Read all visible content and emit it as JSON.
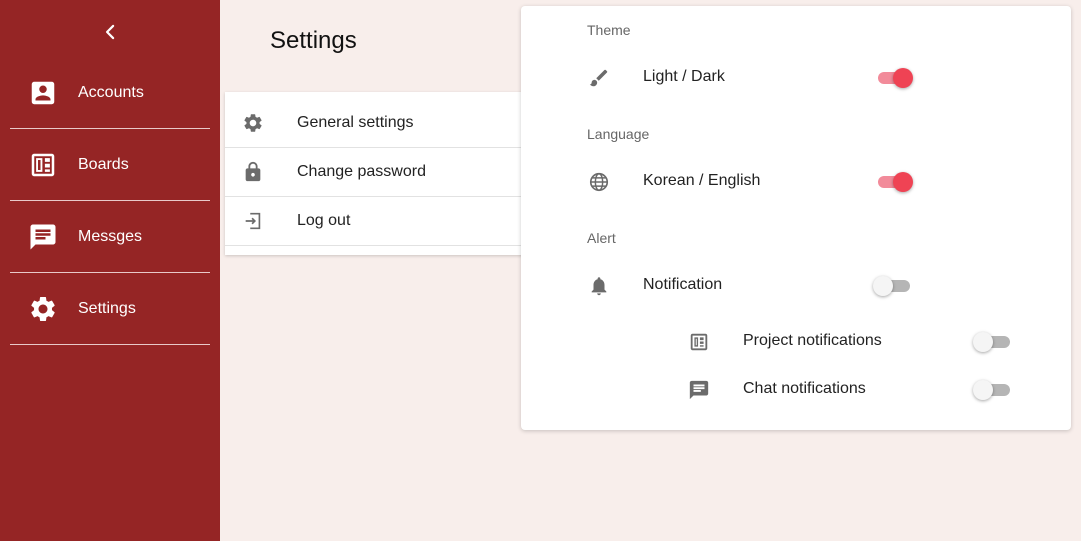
{
  "sidebar": {
    "back_icon": "chevron-left-icon",
    "items": [
      {
        "label": "Accounts",
        "icon": "account-box-icon"
      },
      {
        "label": "Boards",
        "icon": "dashboard-icon"
      },
      {
        "label": "Messges",
        "icon": "message-icon"
      },
      {
        "label": "Settings",
        "icon": "gear-icon"
      }
    ]
  },
  "page": {
    "title": "Settings"
  },
  "menu": {
    "items": [
      {
        "label": "General settings",
        "icon": "gear-icon"
      },
      {
        "label": "Change password",
        "icon": "lock-icon"
      },
      {
        "label": "Log out",
        "icon": "logout-icon"
      }
    ]
  },
  "panel": {
    "sections": {
      "theme": {
        "label": "Theme",
        "row_label": "Light / Dark",
        "enabled": true,
        "icon": "brush-icon"
      },
      "language": {
        "label": "Language",
        "row_label": "Korean / English",
        "enabled": true,
        "icon": "globe-icon"
      },
      "alert": {
        "label": "Alert",
        "row_label": "Notification",
        "enabled": false,
        "icon": "bell-icon"
      }
    },
    "sub_notifications": [
      {
        "label": "Project notifications",
        "enabled": false,
        "icon": "dashboard-icon"
      },
      {
        "label": "Chat notifications",
        "enabled": false,
        "icon": "message-icon"
      }
    ]
  },
  "colors": {
    "sidebar_bg": "#952525",
    "page_bg": "#f8eeeb",
    "toggle_on": "#ef4354",
    "toggle_on_track": "#f28b9a",
    "toggle_off_track": "#b5b5b5"
  }
}
